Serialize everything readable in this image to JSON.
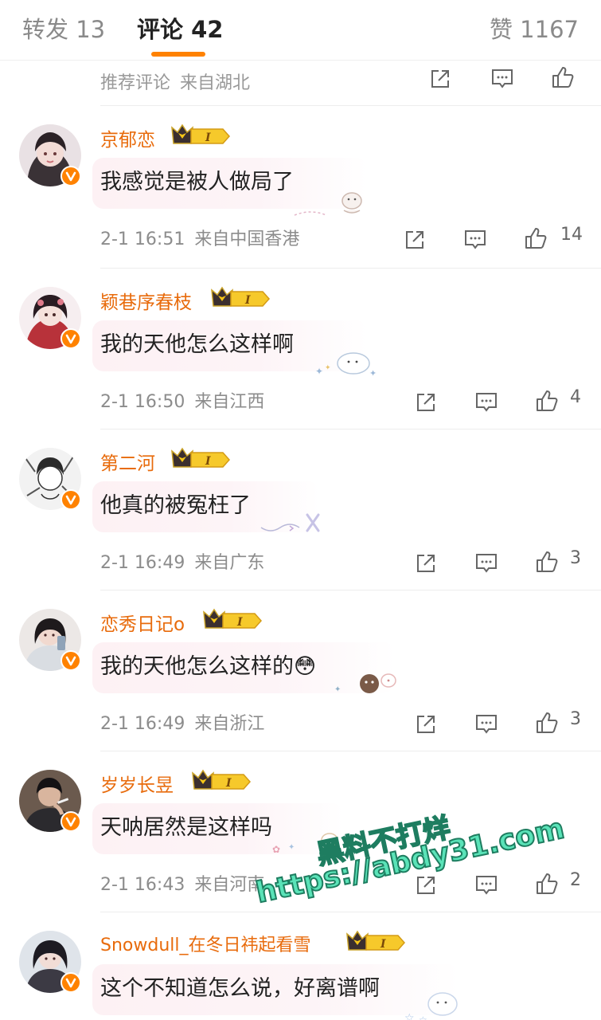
{
  "tabs": {
    "repost": "转发 13",
    "comment": "评论 42",
    "like": "赞 1167"
  },
  "recommended": {
    "tag": "推荐评论",
    "location": "来自湖北"
  },
  "colors": {
    "accent": "#ff8200",
    "username": "#e86b0c",
    "meta": "#8c8c8c"
  },
  "comments": [
    {
      "user": "京郁恋",
      "text": "我感觉是被人做局了",
      "time": "2-1 16:51",
      "location": "来自中国香港",
      "likes": "14"
    },
    {
      "user": "颖巷序春枝",
      "text": "我的天他怎么这样啊",
      "time": "2-1 16:50",
      "location": "来自江西",
      "likes": "4"
    },
    {
      "user": "第二河",
      "text": "他真的被冤枉了",
      "time": "2-1 16:49",
      "location": "来自广东",
      "likes": "3"
    },
    {
      "user": "恋秀日记o",
      "text": "我的天他怎么这样的😳",
      "time": "2-1 16:49",
      "location": "来自浙江",
      "likes": "3"
    },
    {
      "user": "岁岁长昱",
      "text": "天呐居然是这样吗",
      "time": "2-1 16:43",
      "location": "来自河南",
      "likes": "2"
    },
    {
      "user": "Snowdull_在冬日祎起看雪",
      "text": "这个不知道怎么说，好离谱啊",
      "time": "",
      "location": "",
      "likes": ""
    }
  ],
  "watermark": {
    "line1": "黑料不打烊",
    "line2": "https://abdy31.com"
  },
  "icons": {
    "share": "share-icon",
    "comment": "comment-icon",
    "like": "thumb-up-icon",
    "crown": "crown-badge-icon",
    "verified": "verified-badge-icon"
  }
}
